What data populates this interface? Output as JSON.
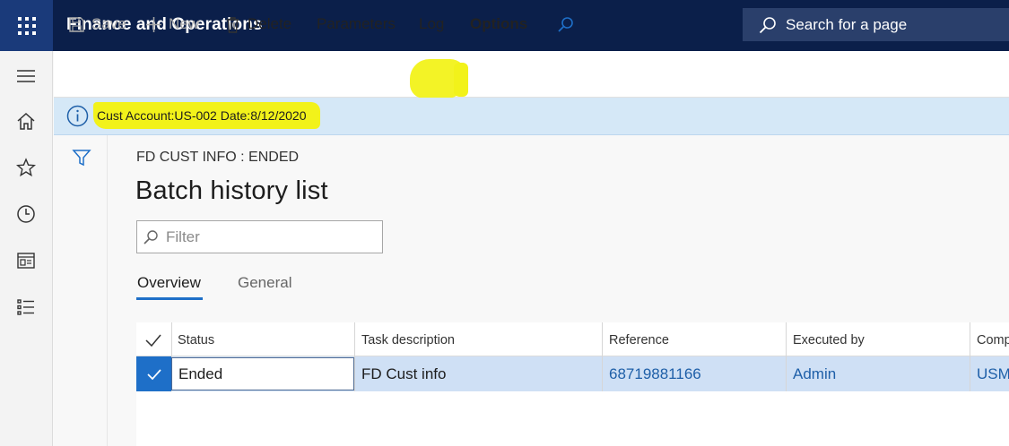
{
  "app": {
    "title": "Finance and Operations"
  },
  "search": {
    "label": "Search for a page"
  },
  "nav": {
    "icons": [
      "hamburger-icon",
      "home-icon",
      "star-icon",
      "clock-icon",
      "workspace-icon",
      "list-icon"
    ]
  },
  "actions": {
    "save": "Save",
    "new": "New",
    "delete": "Delete",
    "parameters": "Parameters",
    "log": "Log",
    "options": "Options"
  },
  "info": {
    "message": "Cust Account:US-002 Date:8/12/2020"
  },
  "page": {
    "caption": "FD CUST INFO : ENDED",
    "title": "Batch history list",
    "filter_placeholder": "Filter"
  },
  "tabs": [
    {
      "label": "Overview",
      "active": true
    },
    {
      "label": "General",
      "active": false
    }
  ],
  "grid": {
    "columns": [
      "Status",
      "Task description",
      "Reference",
      "Executed by",
      "Comp"
    ],
    "rows": [
      {
        "status": "Ended",
        "task": "FD Cust info",
        "reference": "68719881166",
        "executed_by": "Admin",
        "company": "USM"
      }
    ]
  },
  "colors": {
    "topbar": "#0b1f4a",
    "accent": "#1e6fc8",
    "highlight": "#f2f21a",
    "infobar": "#d5e8f7",
    "selected_row": "#cfe0f5"
  }
}
